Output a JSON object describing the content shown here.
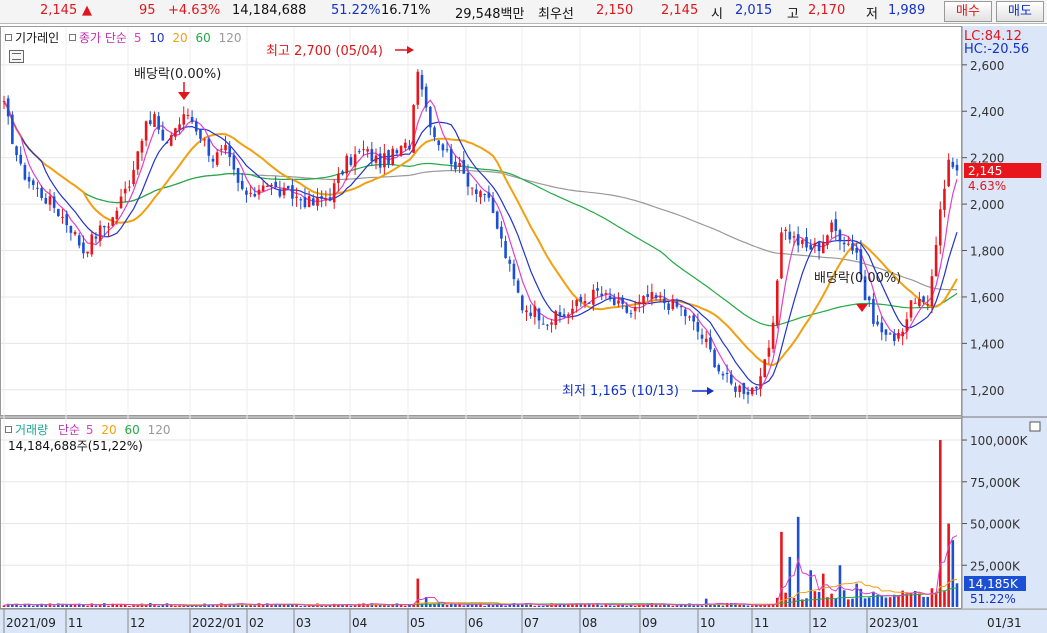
{
  "quote": {
    "price": "2,145",
    "arrow": "▲",
    "change": "95",
    "change_pct": "+4.63%",
    "volume": "14,184,688",
    "vol_ratio": "51.22%",
    "turnover": "16.71%",
    "amount": "29,548백만",
    "best_ask_label": "최우선",
    "best_ask": "2,150",
    "best_bid": "2,145",
    "open_label": "시",
    "open": "2,015",
    "high_label": "고",
    "high": "2,170",
    "low_label": "저",
    "low": "1,989",
    "buy_label": "매수",
    "sell_label": "매도"
  },
  "price_legend": {
    "main": "기가레인",
    "ma_label": "종가 단순",
    "p5": "5",
    "p10": "10",
    "p20": "20",
    "p60": "60",
    "p120": "120"
  },
  "volume_legend": {
    "main": "거래량",
    "ma_label": "단순",
    "p5": "5",
    "p20": "20",
    "p60": "60",
    "p120": "120",
    "value": "14,184,688주(51,22%)"
  },
  "right_info": {
    "lc": "LC:84.12",
    "hc": "HC:-20.56",
    "price_tag": "2,145",
    "pct_tag": "4.63%",
    "vol_tag": "14,185K",
    "vol_pct": "51.22%"
  },
  "annotations": {
    "high": "최고 2,700 (05/04)",
    "low": "최저 1,165 (10/13)",
    "div1": "배당락(0.00%)",
    "div2": "배당락(0.00%)"
  },
  "colors": {
    "up": "#e8161c",
    "down": "#1a4fd6",
    "ma5": "#e040c8",
    "ma10": "#2233cc",
    "ma20": "#f0a010",
    "ma60": "#22aa44",
    "ma120": "#999999"
  },
  "chart_data": [
    {
      "type": "candlestick",
      "title": "기가레인",
      "ylim": [
        1100,
        2750
      ],
      "y_ticks": [
        "2,600",
        "2,400",
        "2,200",
        "2,000",
        "1,800",
        "1,600",
        "1,400",
        "1,200"
      ],
      "y_tick_values": [
        2600,
        2400,
        2200,
        2000,
        1800,
        1600,
        1400,
        1200
      ],
      "x_tick_labels": [
        "2021/09",
        "11",
        "12",
        "2022/01",
        "02",
        "03",
        "04",
        "05",
        "06",
        "07",
        "08",
        "09",
        "10",
        "11",
        "12",
        "2023/01",
        "01/31"
      ],
      "close_anchors": [
        [
          0,
          2420
        ],
        [
          4,
          2150
        ],
        [
          8,
          2060
        ],
        [
          12,
          1990
        ],
        [
          16,
          1900
        ],
        [
          19,
          1800
        ],
        [
          22,
          1870
        ],
        [
          26,
          1940
        ],
        [
          30,
          2100
        ],
        [
          33,
          2300
        ],
        [
          36,
          2380
        ],
        [
          38,
          2250
        ],
        [
          41,
          2330
        ],
        [
          44,
          2390
        ],
        [
          47,
          2300
        ],
        [
          50,
          2200
        ],
        [
          53,
          2230
        ],
        [
          56,
          2080
        ],
        [
          59,
          2020
        ],
        [
          62,
          2100
        ],
        [
          66,
          2050
        ],
        [
          70,
          2030
        ],
        [
          74,
          2000
        ],
        [
          78,
          2040
        ],
        [
          82,
          2180
        ],
        [
          86,
          2230
        ],
        [
          90,
          2180
        ],
        [
          94,
          2220
        ],
        [
          97,
          2260
        ],
        [
          99,
          2600
        ],
        [
          101,
          2420
        ],
        [
          103,
          2300
        ],
        [
          106,
          2220
        ],
        [
          109,
          2150
        ],
        [
          112,
          2080
        ],
        [
          115,
          2050
        ],
        [
          118,
          1900
        ],
        [
          121,
          1720
        ],
        [
          124,
          1560
        ],
        [
          127,
          1540
        ],
        [
          130,
          1500
        ],
        [
          134,
          1520
        ],
        [
          138,
          1580
        ],
        [
          142,
          1620
        ],
        [
          146,
          1570
        ],
        [
          150,
          1530
        ],
        [
          154,
          1600
        ],
        [
          158,
          1580
        ],
        [
          162,
          1550
        ],
        [
          165,
          1480
        ],
        [
          168,
          1400
        ],
        [
          171,
          1290
        ],
        [
          174,
          1220
        ],
        [
          178,
          1200
        ],
        [
          181,
          1230
        ],
        [
          184,
          1460
        ],
        [
          186,
          1900
        ],
        [
          189,
          1850
        ],
        [
          192,
          1810
        ],
        [
          195,
          1820
        ],
        [
          198,
          1900
        ],
        [
          201,
          1850
        ],
        [
          204,
          1800
        ],
        [
          206,
          1600
        ],
        [
          209,
          1470
        ],
        [
          212,
          1420
        ],
        [
          215,
          1470
        ],
        [
          218,
          1600
        ],
        [
          221,
          1540
        ],
        [
          224,
          1990
        ],
        [
          226,
          2180
        ],
        [
          228,
          2145
        ]
      ],
      "moving_averages": [
        "5",
        "10",
        "20",
        "60",
        "120"
      ],
      "current_price": 2145,
      "change_pct": "4.63%"
    },
    {
      "type": "bar",
      "title": "거래량",
      "ylim": [
        0,
        112000
      ],
      "y_ticks": [
        "100,000K",
        "75,000K",
        "50,000K",
        "25,000K"
      ],
      "y_tick_values": [
        100000,
        75000,
        50000,
        25000
      ],
      "spikes_k": [
        [
          99,
          17000
        ],
        [
          101,
          6000
        ],
        [
          168,
          5000
        ],
        [
          186,
          45000
        ],
        [
          188,
          30000
        ],
        [
          190,
          54000
        ],
        [
          193,
          22000
        ],
        [
          196,
          20000
        ],
        [
          200,
          25000
        ],
        [
          204,
          14000
        ],
        [
          224,
          100000
        ],
        [
          226,
          50000
        ],
        [
          227,
          40000
        ],
        [
          228,
          14185
        ]
      ],
      "current_volume": "14,185K"
    }
  ]
}
